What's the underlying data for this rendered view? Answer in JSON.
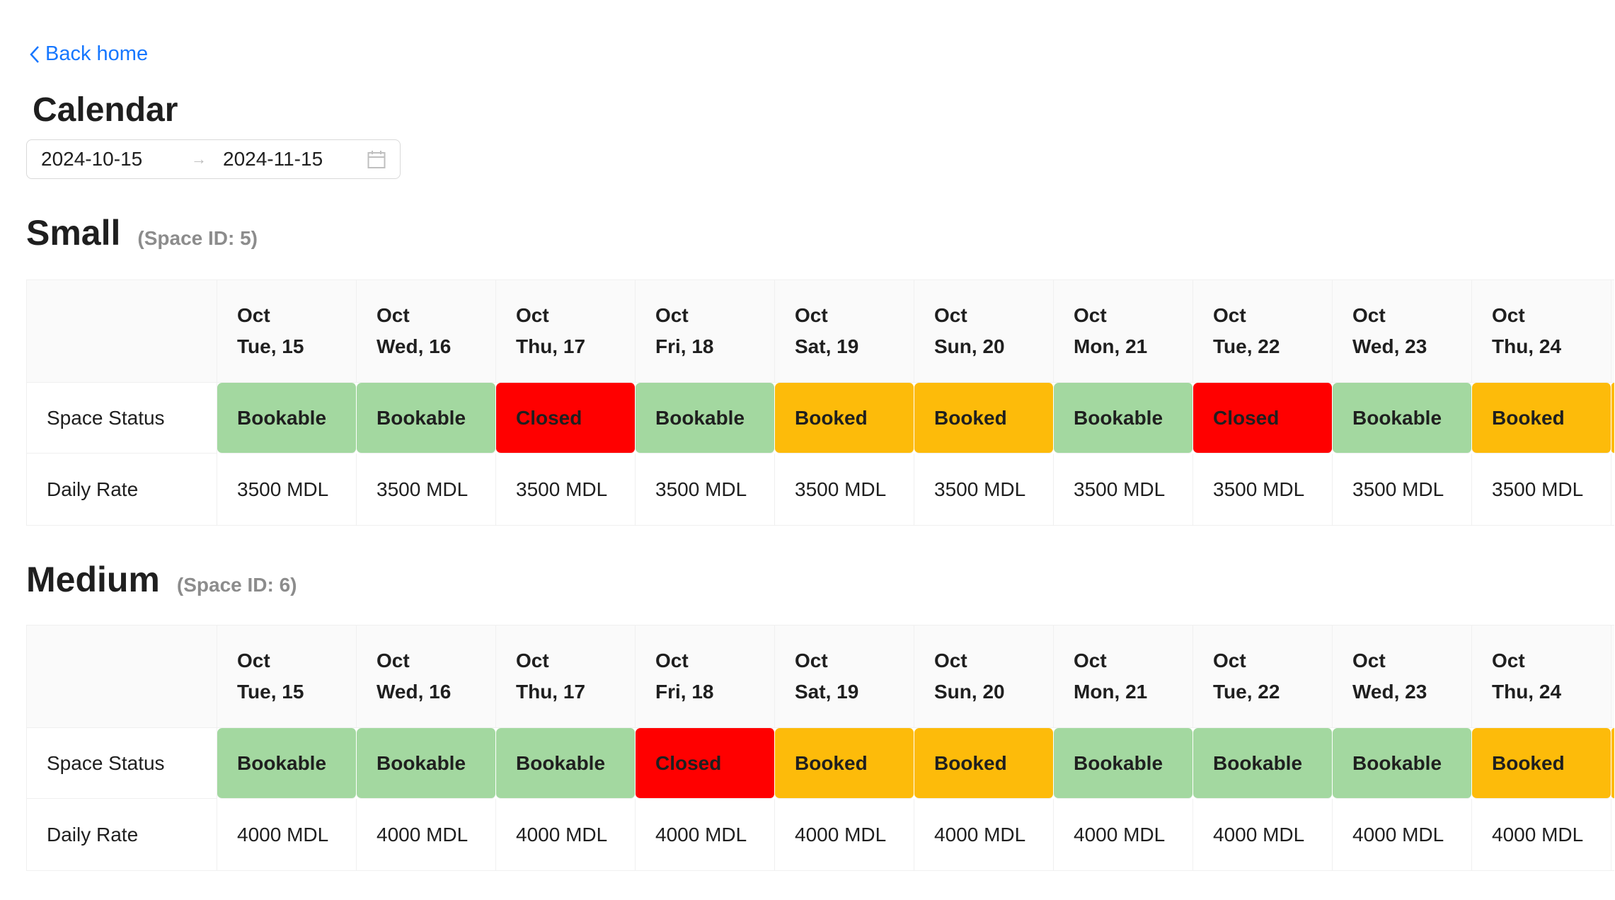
{
  "nav": {
    "back_label": "Back home"
  },
  "page": {
    "title": "Calendar"
  },
  "date_range": {
    "start": "2024-10-15",
    "end": "2024-11-15",
    "separator": "→"
  },
  "colors": {
    "Bookable": "#a3d8a0",
    "Closed": "#ff0000",
    "Booked": "#fdbb0a",
    "link": "#1677ff"
  },
  "row_labels": {
    "status": "Space Status",
    "rate": "Daily Rate"
  },
  "spaces": [
    {
      "name": "Small",
      "id_label": "(Space ID: 5)",
      "days": [
        {
          "month": "Oct",
          "day": "Tue, 15",
          "status": "Bookable",
          "rate": "3500 MDL"
        },
        {
          "month": "Oct",
          "day": "Wed, 16",
          "status": "Bookable",
          "rate": "3500 MDL"
        },
        {
          "month": "Oct",
          "day": "Thu, 17",
          "status": "Closed",
          "rate": "3500 MDL"
        },
        {
          "month": "Oct",
          "day": "Fri, 18",
          "status": "Bookable",
          "rate": "3500 MDL"
        },
        {
          "month": "Oct",
          "day": "Sat, 19",
          "status": "Booked",
          "rate": "3500 MDL"
        },
        {
          "month": "Oct",
          "day": "Sun, 20",
          "status": "Booked",
          "rate": "3500 MDL"
        },
        {
          "month": "Oct",
          "day": "Mon, 21",
          "status": "Bookable",
          "rate": "3500 MDL"
        },
        {
          "month": "Oct",
          "day": "Tue, 22",
          "status": "Closed",
          "rate": "3500 MDL"
        },
        {
          "month": "Oct",
          "day": "Wed, 23",
          "status": "Bookable",
          "rate": "3500 MDL"
        },
        {
          "month": "Oct",
          "day": "Thu, 24",
          "status": "Booked",
          "rate": "3500 MDL"
        }
      ],
      "overflow_status": "Booked"
    },
    {
      "name": "Medium",
      "id_label": "(Space ID: 6)",
      "days": [
        {
          "month": "Oct",
          "day": "Tue, 15",
          "status": "Bookable",
          "rate": "4000 MDL"
        },
        {
          "month": "Oct",
          "day": "Wed, 16",
          "status": "Bookable",
          "rate": "4000 MDL"
        },
        {
          "month": "Oct",
          "day": "Thu, 17",
          "status": "Bookable",
          "rate": "4000 MDL"
        },
        {
          "month": "Oct",
          "day": "Fri, 18",
          "status": "Closed",
          "rate": "4000 MDL"
        },
        {
          "month": "Oct",
          "day": "Sat, 19",
          "status": "Booked",
          "rate": "4000 MDL"
        },
        {
          "month": "Oct",
          "day": "Sun, 20",
          "status": "Booked",
          "rate": "4000 MDL"
        },
        {
          "month": "Oct",
          "day": "Mon, 21",
          "status": "Bookable",
          "rate": "4000 MDL"
        },
        {
          "month": "Oct",
          "day": "Tue, 22",
          "status": "Bookable",
          "rate": "4000 MDL"
        },
        {
          "month": "Oct",
          "day": "Wed, 23",
          "status": "Bookable",
          "rate": "4000 MDL"
        },
        {
          "month": "Oct",
          "day": "Thu, 24",
          "status": "Booked",
          "rate": "4000 MDL"
        }
      ],
      "overflow_status": "Booked"
    }
  ]
}
